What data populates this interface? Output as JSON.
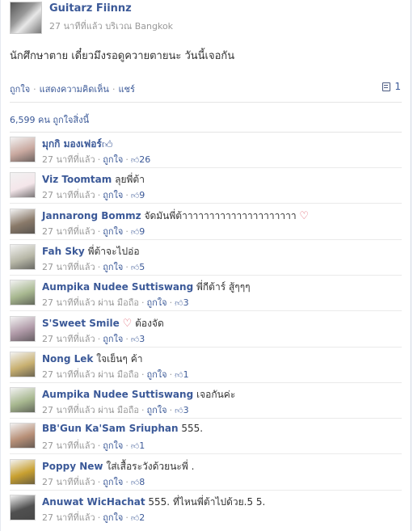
{
  "post": {
    "author": "Guitarz Fiinnz",
    "meta": "27 นาทีที่แล้ว บริเวณ Bangkok",
    "text": "นักศึกษาตาย เดี๋ยวมึงรอดูควายตายนะ วันนี้เจอกัน"
  },
  "actions": {
    "like": "ถูกใจ",
    "comment": "แสดงความคิดเห็น",
    "share": "แชร์",
    "comment_count": "1"
  },
  "likes_line": "6,599 คน ถูกใจสิ่งนี้",
  "comments": [
    {
      "name": "มุกกิ มองเฟอร์",
      "text": "",
      "thumb_after_name": true,
      "time": "27 นาทีที่แล้ว",
      "via": "",
      "like": "ถูกใจ",
      "count": "26",
      "avatar": "#c9a9a0"
    },
    {
      "name": "Viz Toomtam",
      "text": "ลุยพี่ต้า",
      "time": "27 นาทีที่แล้ว",
      "via": "",
      "like": "ถูกใจ",
      "count": "9",
      "avatar": "#f4e6ea"
    },
    {
      "name": "Jannarong Bommz",
      "text": "จัดมันพี่ต้าาาาาาาาาาาาาาาาาาาาา",
      "heart_after_text": true,
      "time": "27 นาทีที่แล้ว",
      "via": "",
      "like": "ถูกใจ",
      "count": "9",
      "avatar": "#8a7a6a"
    },
    {
      "name": "Fah Sky",
      "text": "พี่ต้าจะไปอ่อ",
      "time": "27 นาทีที่แล้ว",
      "via": "",
      "like": "ถูกใจ",
      "count": "5",
      "avatar": "#b8b8a8"
    },
    {
      "name": "Aumpika Nudee Suttiswang",
      "text": "พี่กีต้าร์ สู้ๆๆๆ",
      "time": "27 นาทีที่แล้ว",
      "via": "ผ่าน มือถือ",
      "like": "ถูกใจ",
      "count": "3",
      "avatar": "#a8b890"
    },
    {
      "name": "S'Sweet Smile",
      "text": "ต้องจัด",
      "heart_after_name": true,
      "time": "27 นาทีที่แล้ว",
      "via": "",
      "like": "ถูกใจ",
      "count": "3",
      "avatar": "#b09aa8"
    },
    {
      "name": "Nong Lek",
      "text": "ใจเย็นๆ ค้า",
      "time": "27 นาทีที่แล้ว",
      "via": "ผ่าน มือถือ",
      "like": "ถูกใจ",
      "count": "1",
      "avatar": "#c8b070"
    },
    {
      "name": "Aumpika Nudee Suttiswang",
      "text": "เจอกันค่ะ",
      "time": "27 นาทีที่แล้ว",
      "via": "ผ่าน มือถือ",
      "like": "ถูกใจ",
      "count": "3",
      "avatar": "#a8b890"
    },
    {
      "name": "BB'Gun Ka'Sam Sriuphan",
      "text": "555.",
      "time": "27 นาทีที่แล้ว",
      "via": "",
      "like": "ถูกใจ",
      "count": "1",
      "avatar": "#b89078"
    },
    {
      "name": "Poppy New",
      "text": "ใส่เสื้อระวังด้วยนะพี่ .",
      "time": "27 นาทีที่แล้ว",
      "via": "",
      "like": "ถูกใจ",
      "count": "8",
      "avatar": "#c8a030"
    },
    {
      "name": "Anuwat WicHachat",
      "text": "555. ที่ไหนพี่ต้าไปด้วย.5 5.",
      "time": "27 นาทีที่แล้ว",
      "via": "",
      "like": "ถูกใจ",
      "count": "2",
      "avatar": "#505050"
    }
  ]
}
